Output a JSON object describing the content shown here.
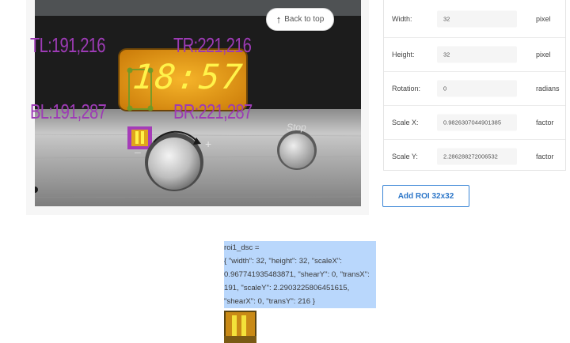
{
  "overlay": {
    "tl": "TL:191,216",
    "tr": "TR:221,216",
    "bl": "BL:191,287",
    "br": "BR:221,287",
    "display_time": "18:57",
    "stop_label": "Stop",
    "plus_label": "+",
    "minus_label": "–"
  },
  "back_to_top": {
    "label": "Back to top",
    "icon": "arrow-up-icon"
  },
  "properties": [
    {
      "label": "Width:",
      "value": "32",
      "unit": "pixel"
    },
    {
      "label": "Height:",
      "value": "32",
      "unit": "pixel"
    },
    {
      "label": "Rotation:",
      "value": "0",
      "unit": "radians"
    },
    {
      "label": "Scale X:",
      "value": "0.9826307044901385",
      "unit": "factor"
    },
    {
      "label": "Scale Y:",
      "value": "2.286288272006532",
      "unit": "factor"
    }
  ],
  "add_roi_label": "Add ROI 32x32",
  "roi_output": {
    "lines": [
      "roi1_dsc =",
      "{ \"width\": 32, \"height\": 32, \"scaleX\":",
      "0.967741935483871, \"shearY\": 0, \"transX\":",
      "191, \"scaleY\": 2.2903225806451615,",
      "\"shearX\": 0, \"transY\": 216 }"
    ]
  },
  "colors": {
    "accent": "#3b86d6",
    "overlay_text": "#9d3bb5",
    "selection": "#b9d7fc",
    "display_glow": "#f2a31a",
    "digit": "#fff34a"
  }
}
